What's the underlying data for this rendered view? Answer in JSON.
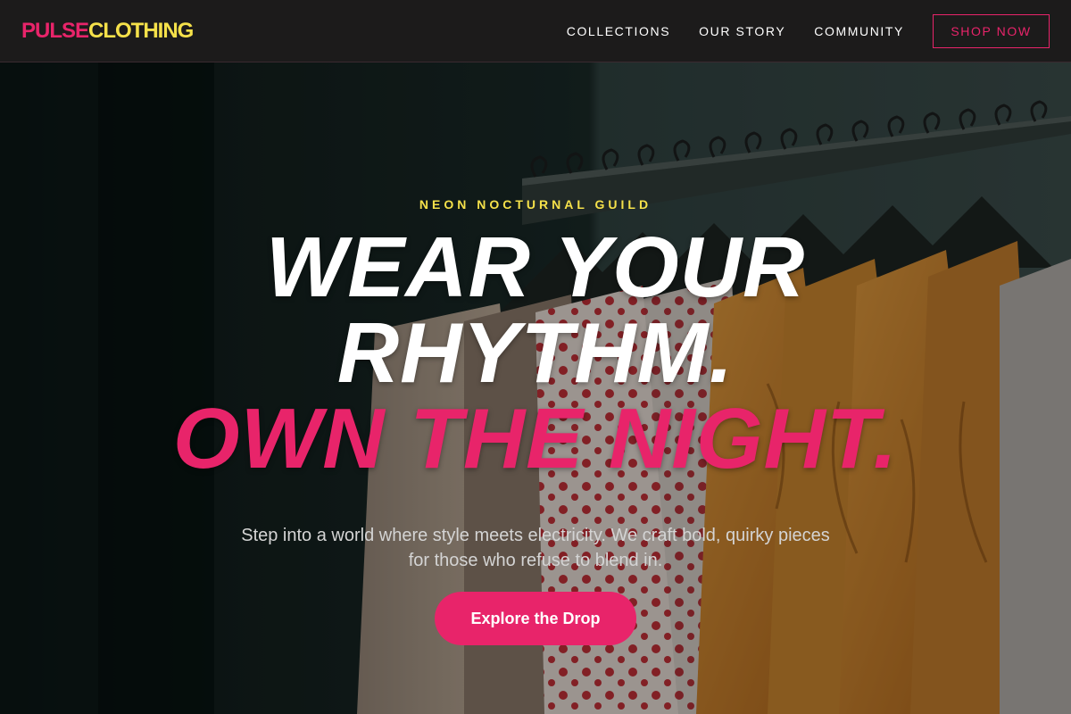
{
  "brand": {
    "part1": "PULSE",
    "part2": "CLOTHING",
    "color_primary": "#e8246a",
    "color_secondary": "#f5e14a"
  },
  "nav": {
    "links": [
      "COLLECTIONS",
      "OUR STORY",
      "COMMUNITY"
    ],
    "shop_button": "SHOP NOW"
  },
  "hero": {
    "eyebrow": "NEON NOCTURNAL GUILD",
    "headline_line1": "WEAR YOUR",
    "headline_line2": "RHYTHM.",
    "headline_line3": "OWN THE NIGHT.",
    "subtext": "Step into a world where style meets electricity. We craft bold, quirky pieces for those who refuse to blend in.",
    "cta": "Explore the Drop",
    "background_image": "clothing-rack-photo"
  },
  "colors": {
    "accent_pink": "#e8246a",
    "accent_yellow": "#f5e14a",
    "nav_background": "#1c1b1b"
  }
}
